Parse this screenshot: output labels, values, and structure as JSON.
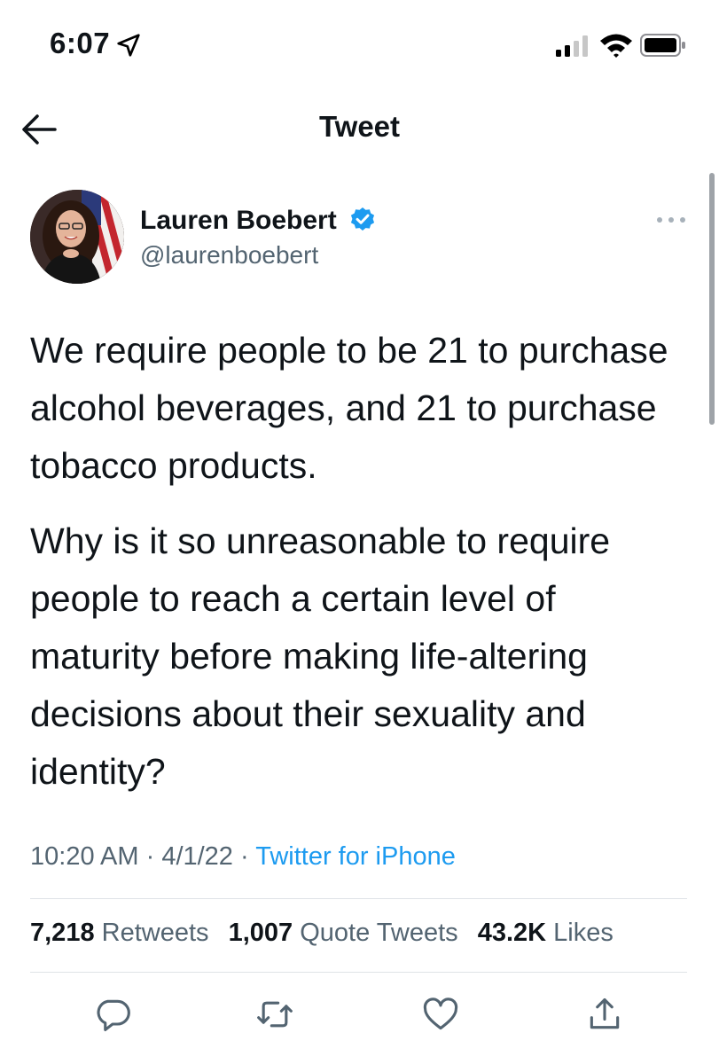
{
  "status_bar": {
    "time": "6:07"
  },
  "header": {
    "title": "Tweet",
    "back_icon": "arrow-left-icon"
  },
  "author": {
    "name": "Lauren Boebert",
    "handle": "@laurenboebert",
    "verified": true
  },
  "tweet": {
    "paragraphs": [
      "We require people to be 21 to purchase alcohol beverages, and 21 to purchase tobacco products.",
      "Why is it so unreasonable to require people to reach a certain level of maturity before making life-altering decisions about their sexuality and identity?"
    ],
    "time": "10:20 AM",
    "separator": " · ",
    "date": "4/1/22",
    "source": "Twitter for iPhone"
  },
  "stats": {
    "retweets": {
      "count": "7,218",
      "label": "Retweets"
    },
    "quotes": {
      "count": "1,007",
      "label": "Quote Tweets"
    },
    "likes": {
      "count": "43.2K",
      "label": "Likes"
    }
  },
  "actions": [
    "reply-icon",
    "retweet-icon",
    "like-icon",
    "share-icon"
  ],
  "colors": {
    "accent": "#1d9bf0",
    "text": "#0f1419",
    "secondary": "#536471"
  }
}
